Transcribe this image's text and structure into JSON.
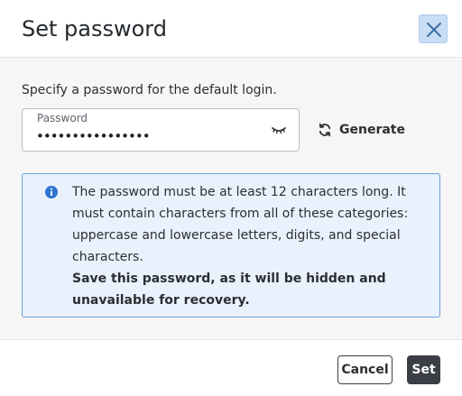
{
  "dialog": {
    "title": "Set password",
    "close_icon": "close-icon"
  },
  "body": {
    "intro": "Specify a password for the default login.",
    "password_field": {
      "label": "Password",
      "value": "••••••••••••••••",
      "toggle_icon": "eye-closed-icon"
    },
    "generate": {
      "label": "Generate",
      "icon": "refresh-icon"
    },
    "alert": {
      "icon": "info-icon",
      "line1": "The password must be at least 12 characters long. It must contain characters from all of these categories: uppercase and lowercase letters, digits, and special characters.",
      "line2": "Save this password, as it will be hidden and unavailable for recovery."
    }
  },
  "footer": {
    "cancel_label": "Cancel",
    "set_label": "Set"
  },
  "colors": {
    "accent": "#6a9fdc",
    "alert_background": "#e9f1fc",
    "primary_button": "#3b3f45",
    "close_button": "#c9ddf5"
  }
}
